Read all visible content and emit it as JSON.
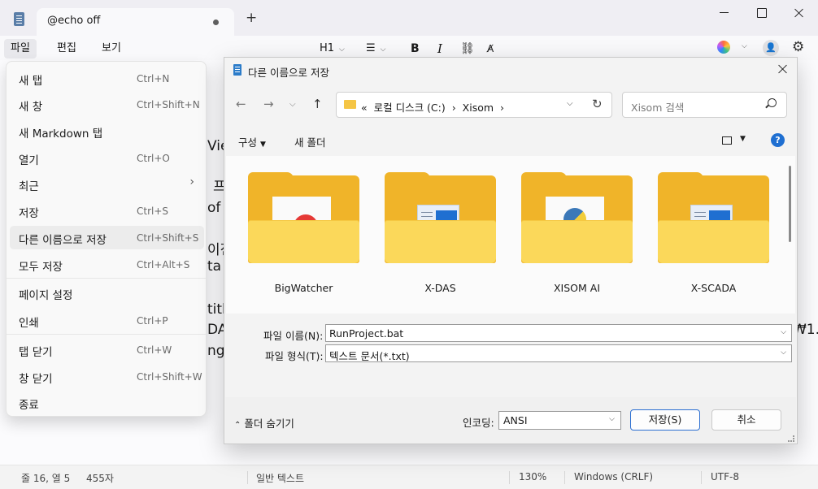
{
  "titlebar": {
    "tab_title": "@echo off",
    "add_tab": "+"
  },
  "menubar": {
    "file": "파일",
    "edit": "편집",
    "view": "보기",
    "heading": "H1",
    "bold": "B",
    "italic": "I"
  },
  "editor_fragments": [
    "Vie",
    "프",
    "of",
    "이전",
    "ta",
    "titl",
    "DA",
    "ng",
    "₩1."
  ],
  "file_menu": {
    "items": [
      {
        "label": "새 탭",
        "shortcut": "Ctrl+N"
      },
      {
        "label": "새 창",
        "shortcut": "Ctrl+Shift+N"
      },
      {
        "label": "새 Markdown 탭",
        "shortcut": ""
      },
      {
        "label": "열기",
        "shortcut": "Ctrl+O"
      },
      {
        "label": "최근",
        "shortcut": ""
      },
      {
        "label": "저장",
        "shortcut": "Ctrl+S"
      },
      {
        "label": "다른 이름으로 저장",
        "shortcut": "Ctrl+Shift+S"
      },
      {
        "label": "모두 저장",
        "shortcut": "Ctrl+Alt+S"
      },
      {
        "label": "페이지 설정",
        "shortcut": ""
      },
      {
        "label": "인쇄",
        "shortcut": "Ctrl+P"
      },
      {
        "label": "탭 닫기",
        "shortcut": "Ctrl+W"
      },
      {
        "label": "창 닫기",
        "shortcut": "Ctrl+Shift+W"
      },
      {
        "label": "종료",
        "shortcut": ""
      }
    ]
  },
  "dialog": {
    "title": "다른 이름으로 저장",
    "address": {
      "prefix": "«",
      "drive": "로컬 디스크 (C:)",
      "folder": "Xisom"
    },
    "search_placeholder": "Xisom 검색",
    "organize": "구성",
    "new_folder": "새 폴더",
    "help": "?",
    "folders": [
      {
        "name": "BigWatcher",
        "icon": "red-doc"
      },
      {
        "name": "X-DAS",
        "icon": "window-doc"
      },
      {
        "name": "XISOM AI",
        "icon": "python-doc"
      },
      {
        "name": "X-SCADA",
        "icon": "window-doc"
      }
    ],
    "filename_label": "파일 이름(N):",
    "filename_value": "RunProject.bat",
    "filetype_label": "파일 형식(T):",
    "filetype_value": "텍스트 문서(*.txt)",
    "hide_folders": "폴더 숨기기",
    "encoding_label": "인코딩:",
    "encoding_value": "ANSI",
    "save_button": "저장(S)",
    "cancel_button": "취소"
  },
  "statusbar": {
    "position": "줄 16, 열 5",
    "chars": "455자",
    "mode": "일반 텍스트",
    "zoom": "130%",
    "line_ending": "Windows (CRLF)",
    "encoding": "UTF-8"
  },
  "colors": {
    "accent": "#2c6fd1",
    "folder": "#f0b429",
    "folder_front": "#fbd85a"
  }
}
